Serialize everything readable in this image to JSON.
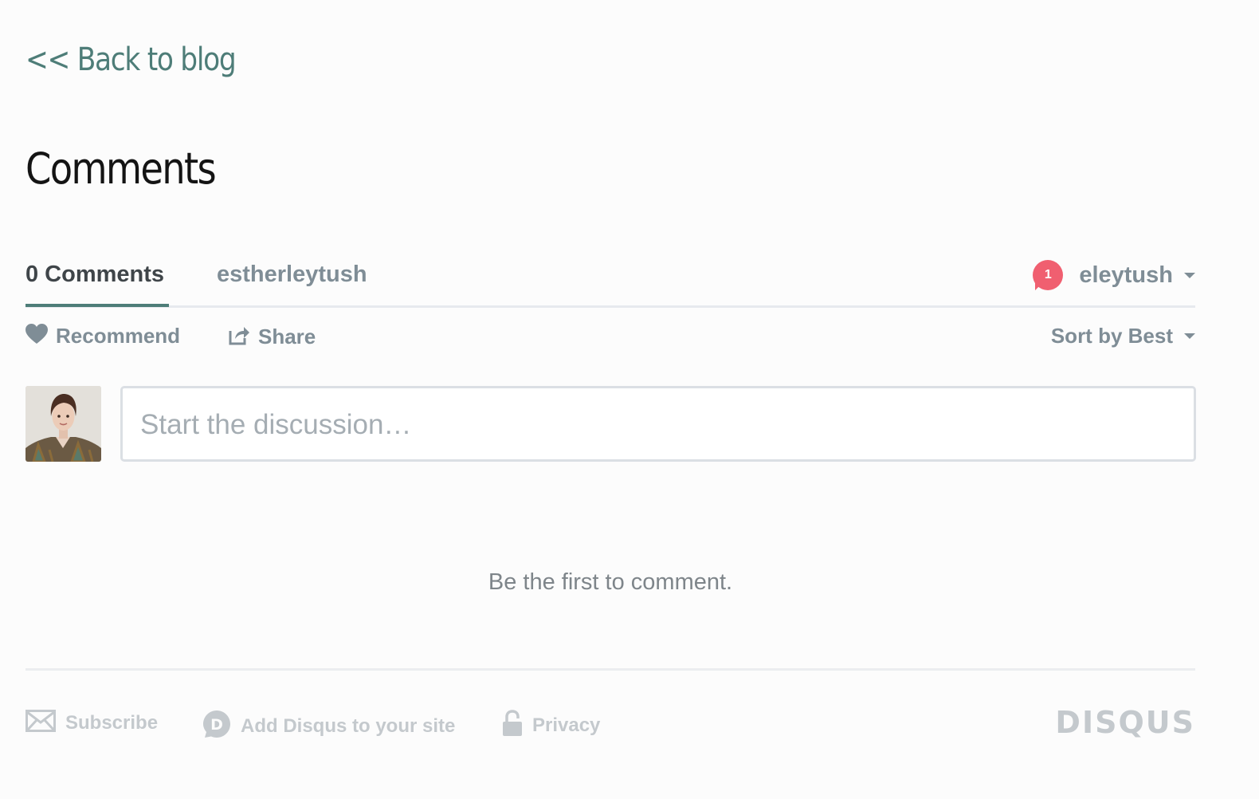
{
  "back_link": {
    "label": "<< Back to blog"
  },
  "page_title": "Comments",
  "thread_nav": {
    "count_tab": "0 Comments",
    "community_tab": "estherleytush",
    "notification_count": "1",
    "user_name": "eleytush"
  },
  "actions": {
    "recommend": "Recommend",
    "share": "Share",
    "sort": "Sort by Best"
  },
  "composer": {
    "placeholder": "Start the discussion…"
  },
  "empty_message": "Be the first to comment.",
  "footer": {
    "subscribe": "Subscribe",
    "add_disqus": "Add Disqus to your site",
    "privacy": "Privacy",
    "logo": "DISQUS"
  },
  "colors": {
    "accent": "#4e7d78",
    "muted": "#7f8d96",
    "badge": "#f05f70",
    "footer_text": "#c4c9cd"
  },
  "icons": [
    "heart-icon",
    "share-icon",
    "caret-down-icon",
    "envelope-icon",
    "disqus-d-icon",
    "lock-icon"
  ]
}
